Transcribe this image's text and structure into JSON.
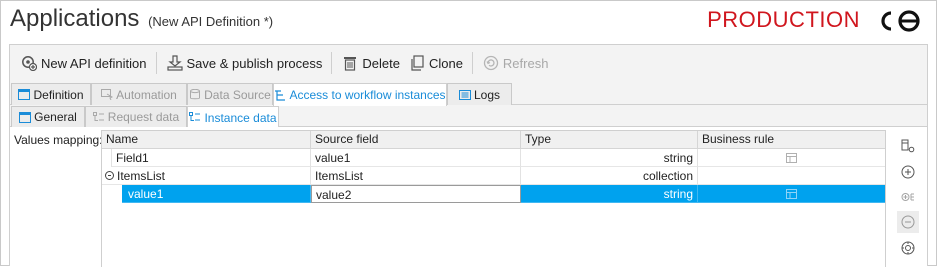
{
  "header": {
    "title": "Applications",
    "subtitle": "(New API Definition *)",
    "environment": "PRODUCTION"
  },
  "toolbar": {
    "new_api": "New API definition",
    "save_publish": "Save & publish process",
    "delete": "Delete",
    "clone": "Clone",
    "refresh": "Refresh"
  },
  "tabs": [
    {
      "label": "Definition",
      "state": "normal"
    },
    {
      "label": "Automation",
      "state": "disabled"
    },
    {
      "label": "Data Source",
      "state": "disabled"
    },
    {
      "label": "Access to workflow instances",
      "state": "active"
    },
    {
      "label": "Logs",
      "state": "normal"
    }
  ],
  "subtabs": [
    {
      "label": "General",
      "state": "normal"
    },
    {
      "label": "Request data",
      "state": "disabled"
    },
    {
      "label": "Instance data",
      "state": "active"
    }
  ],
  "mapping": {
    "label": "Values mapping:",
    "columns": [
      "Name",
      "Source field",
      "Type",
      "Business rule"
    ],
    "rows": [
      {
        "name": "Field1",
        "source": "value1",
        "type": "string",
        "level": 0,
        "selected": false
      },
      {
        "name": "ItemsList",
        "source": "ItemsList",
        "type": "collection",
        "level": 0,
        "selected": false
      },
      {
        "name": "value1",
        "source": "value2",
        "type": "string",
        "level": 1,
        "selected": true
      }
    ]
  },
  "colors": {
    "accent": "#1a8cd8",
    "selection": "#00a2ee",
    "environment": "#d0161e"
  }
}
